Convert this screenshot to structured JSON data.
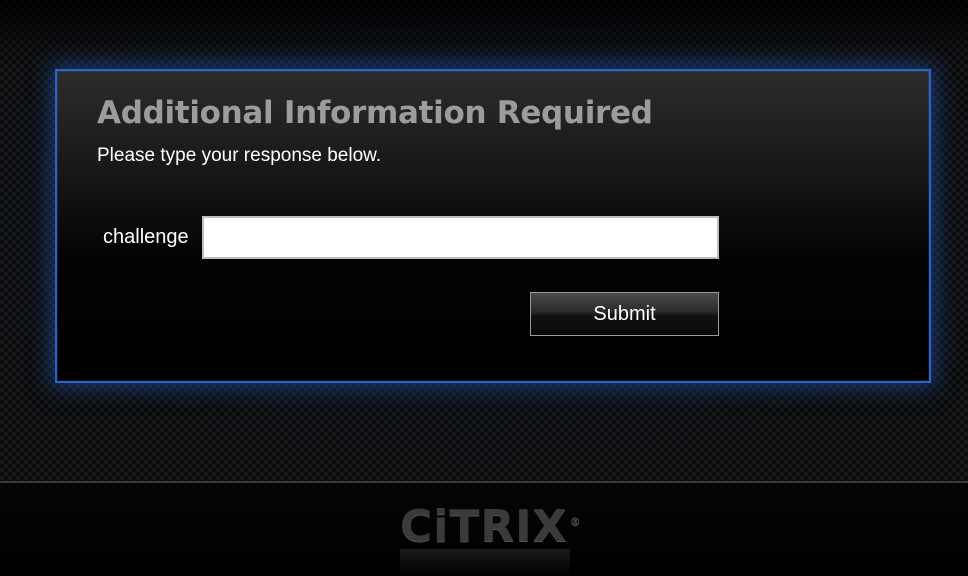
{
  "dialog": {
    "title": "Additional Information Required",
    "subtitle": "Please type your response below."
  },
  "form": {
    "challenge_label": "challenge",
    "challenge_value": "",
    "submit_label": "Submit"
  },
  "footer": {
    "logo_text": "CiTRIX",
    "logo_mark": "®"
  },
  "colors": {
    "panel_border": "#2b63c9",
    "title": "#9c9c9c",
    "background": "#0a0b0d"
  }
}
